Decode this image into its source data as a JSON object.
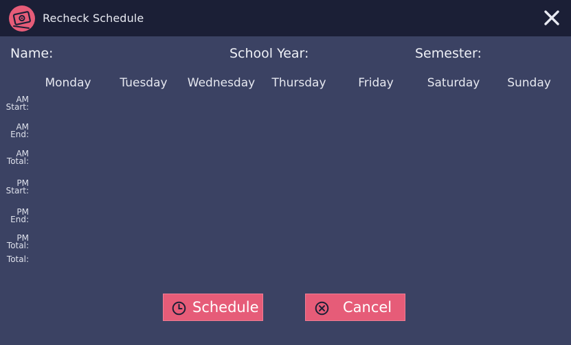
{
  "window": {
    "title": "Recheck Schedule",
    "accent": "#e65c78",
    "titlebar_bg": "#1b1f36",
    "body_bg": "#3b4263"
  },
  "fields": {
    "name_label": "Name:",
    "school_year_label": "School Year:",
    "semester_label": "Semester:"
  },
  "days": [
    "Monday",
    "Tuesday",
    "Wednesday",
    "Thursday",
    "Friday",
    "Saturday",
    "Sunday"
  ],
  "rows": [
    {
      "line1": "AM",
      "line2": "Start:"
    },
    {
      "line1": "AM",
      "line2": "End:"
    },
    {
      "line1": "AM",
      "line2": "Total:"
    },
    {
      "line1": "PM",
      "line2": "Start:"
    },
    {
      "line1": "PM",
      "line2": "End:"
    },
    {
      "line1": "PM",
      "line2": "Total:"
    },
    {
      "line1": "",
      "line2": "Total:"
    }
  ],
  "buttons": {
    "schedule_label": "Schedule",
    "schedule_icon": "clock-icon",
    "cancel_label": "Cancel",
    "cancel_icon": "cancel-circle-icon"
  }
}
